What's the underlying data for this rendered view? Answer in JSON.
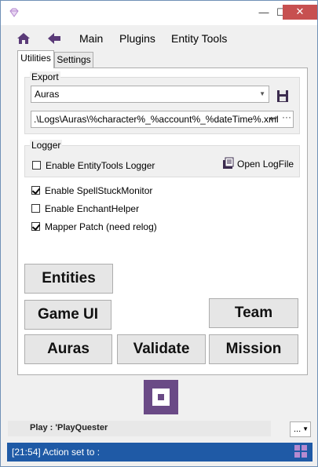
{
  "window": {
    "minimize": "—",
    "maximize": "☐",
    "close": "✕"
  },
  "menu": {
    "items": [
      "Main",
      "Plugins",
      "Entity Tools"
    ]
  },
  "tabs": {
    "utilities": "Utilities",
    "settings": "Settings"
  },
  "export": {
    "group_label": "Export",
    "combo_value": "Auras",
    "path_value": ".\\Logs\\Auras\\%character%_%account%_%dateTime%.xml",
    "undo_glyph": "↩",
    "more_glyph": "···"
  },
  "logger": {
    "group_label": "Logger",
    "enable_label": "Enable EntityTools Logger",
    "enable_checked": false,
    "open_log_label": "Open LogFile"
  },
  "options": [
    {
      "label": "Enable SpellStuckMonitor",
      "checked": true
    },
    {
      "label": "Enable EnchantHelper",
      "checked": false
    },
    {
      "label": "Mapper Patch (need relog)",
      "checked": true
    }
  ],
  "buttons": {
    "entities": "Entities",
    "game_ui": "Game UI",
    "team": "Team",
    "auras": "Auras",
    "validate": "Validate",
    "mission": "Mission"
  },
  "play": {
    "text": "Play : 'PlayQuester",
    "dropdown": "..."
  },
  "status": {
    "text": "[21:54] Action set to :"
  },
  "colors": {
    "accent": "#6a4a86",
    "status_bar": "#1f5aa6",
    "close": "#c75050"
  }
}
